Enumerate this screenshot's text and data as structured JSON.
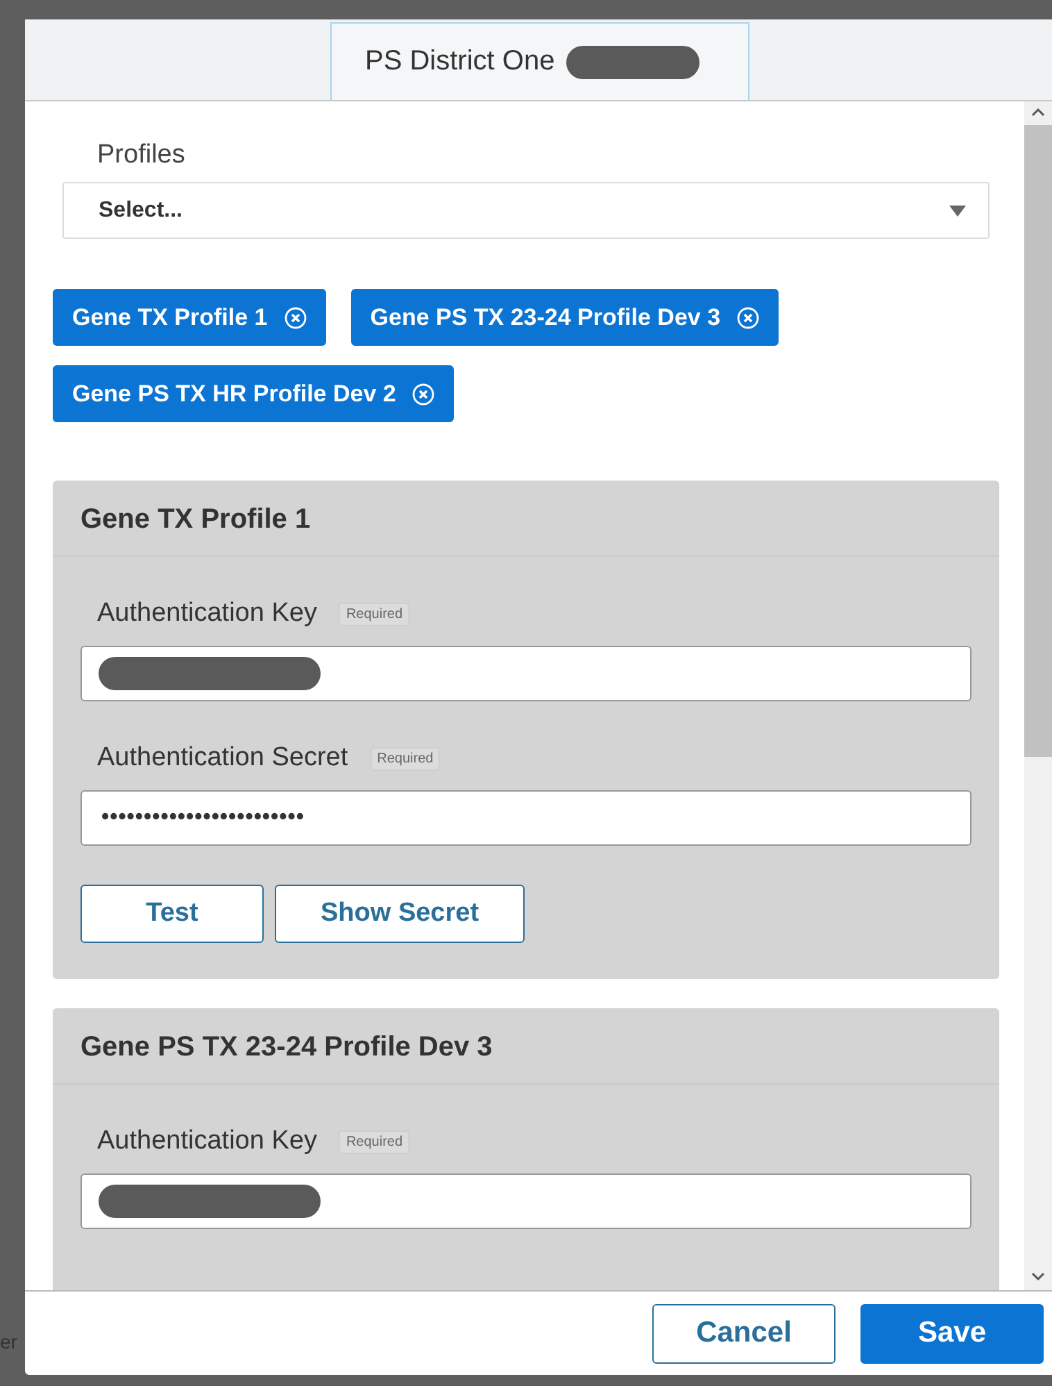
{
  "background_text": "er",
  "dialog": {
    "title": "PS District One",
    "title_redacted": true
  },
  "profiles_field": {
    "label": "Profiles",
    "placeholder": "Select..."
  },
  "chips": [
    {
      "label": "Gene TX Profile 1"
    },
    {
      "label": "Gene PS TX 23-24 Profile Dev 3"
    },
    {
      "label": "Gene PS TX HR Profile Dev 2"
    }
  ],
  "profile_cards": [
    {
      "title": "Gene TX Profile 1",
      "fields": [
        {
          "kind": "text",
          "label": "Authentication Key",
          "badge": "Required",
          "redacted": true
        },
        {
          "kind": "secret",
          "label": "Authentication Secret",
          "badge": "Required",
          "value": "••••••••••••••••••••••••"
        }
      ],
      "buttons": [
        "Test",
        "Show Secret"
      ]
    },
    {
      "title": "Gene PS TX 23-24 Profile Dev 3",
      "fields": [
        {
          "kind": "text",
          "label": "Authentication Key",
          "badge": "Required",
          "redacted": true
        }
      ]
    }
  ],
  "footer": {
    "buttons": [
      {
        "label": "Cancel",
        "kind": "secondary"
      },
      {
        "label": "Save",
        "kind": "primary"
      }
    ]
  }
}
